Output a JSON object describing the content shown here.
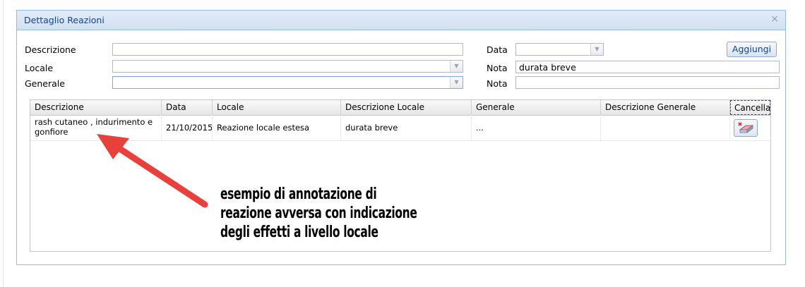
{
  "dialog": {
    "title": "Dettaglio Reazioni",
    "close_glyph": "×"
  },
  "form": {
    "descrizione_label": "Descrizione",
    "descrizione_value": "",
    "locale_label": "Locale",
    "locale_value": "",
    "generale_label": "Generale",
    "generale_value": "",
    "data_label": "Data",
    "data_value": "",
    "nota1_label": "Nota",
    "nota1_value": "durata breve",
    "nota2_label": "Nota",
    "nota2_value": "",
    "add_button": "Aggiungi",
    "combo_trigger_glyph": "▼"
  },
  "grid": {
    "columns": [
      "Descrizione",
      "Data",
      "Locale",
      "Descrizione Locale",
      "Generale",
      "Descrizione Generale",
      "Cancella"
    ],
    "rows": [
      {
        "descrizione": "rash cutaneo , indurimento e gonfiore",
        "data": "21/10/2015",
        "locale": "Reazione locale estesa",
        "descrizione_locale": "durata breve",
        "generale": "...",
        "descrizione_generale": ""
      }
    ]
  },
  "annotation": {
    "line1": "esempio di annotazione di",
    "line2": "reazione avversa con indicazione",
    "line3": "degli effetti a livello locale",
    "arrow_color": "#e8413b"
  },
  "icons": {
    "close": "close-icon",
    "dropdown": "chevron-down-icon",
    "delete": "eraser-delete-icon"
  }
}
